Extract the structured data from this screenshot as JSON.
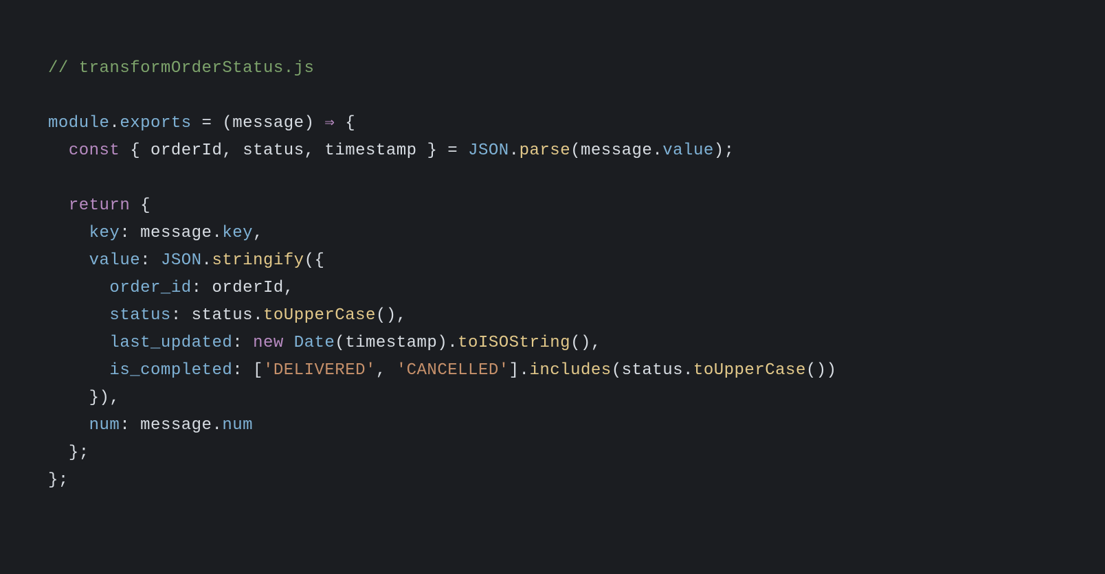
{
  "code": {
    "line1_comment": "// transformOrderStatus.js",
    "line3_module": "module",
    "line3_dot1": ".",
    "line3_exports": "exports",
    "line3_eq": " = (",
    "line3_param": "message",
    "line3_close": ") ",
    "line3_arrow": "⇒",
    "line3_brace": " {",
    "line4_indent": "  ",
    "line4_const": "const",
    "line4_destr_open": " { ",
    "line4_orderId": "orderId",
    "line4_c1": ", ",
    "line4_status": "status",
    "line4_c2": ", ",
    "line4_timestamp": "timestamp",
    "line4_destr_close": " } = ",
    "line4_json": "JSON",
    "line4_dot": ".",
    "line4_parse": "parse",
    "line4_popen": "(",
    "line4_msg": "message",
    "line4_dot2": ".",
    "line4_value": "value",
    "line4_pclose": ");",
    "line6_indent": "  ",
    "line6_return": "return",
    "line6_brace": " {",
    "line7_indent": "    ",
    "line7_key": "key",
    "line7_colon": ": ",
    "line7_msg": "message",
    "line7_dot": ".",
    "line7_keyprop": "key",
    "line7_comma": ",",
    "line8_indent": "    ",
    "line8_value": "value",
    "line8_colon": ": ",
    "line8_json": "JSON",
    "line8_dot": ".",
    "line8_stringify": "stringify",
    "line8_popen": "({",
    "line9_indent": "      ",
    "line9_order_id": "order_id",
    "line9_colon": ": ",
    "line9_orderId": "orderId",
    "line9_comma": ",",
    "line10_indent": "      ",
    "line10_status": "status",
    "line10_colon": ": ",
    "line10_statusvar": "status",
    "line10_dot": ".",
    "line10_toUpper": "toUpperCase",
    "line10_parens": "(),",
    "line11_indent": "      ",
    "line11_last_updated": "last_updated",
    "line11_colon": ": ",
    "line11_new": "new",
    "line11_sp": " ",
    "line11_Date": "Date",
    "line11_popen": "(",
    "line11_timestamp": "timestamp",
    "line11_pclose": ").",
    "line11_toISO": "toISOString",
    "line11_parens": "(),",
    "line12_indent": "      ",
    "line12_is_completed": "is_completed",
    "line12_colon": ": [",
    "line12_str1": "'DELIVERED'",
    "line12_c1": ", ",
    "line12_str2": "'CANCELLED'",
    "line12_close": "].",
    "line12_includes": "includes",
    "line12_popen": "(",
    "line12_status": "status",
    "line12_dot": ".",
    "line12_toUpper": "toUpperCase",
    "line12_parens": "())",
    "line13_indent": "    ",
    "line13_close": "}),",
    "line14_indent": "    ",
    "line14_num": "num",
    "line14_colon": ": ",
    "line14_msg": "message",
    "line14_dot": ".",
    "line14_numprop": "num",
    "line15_indent": "  ",
    "line15_close": "};",
    "line16_close": "};"
  }
}
